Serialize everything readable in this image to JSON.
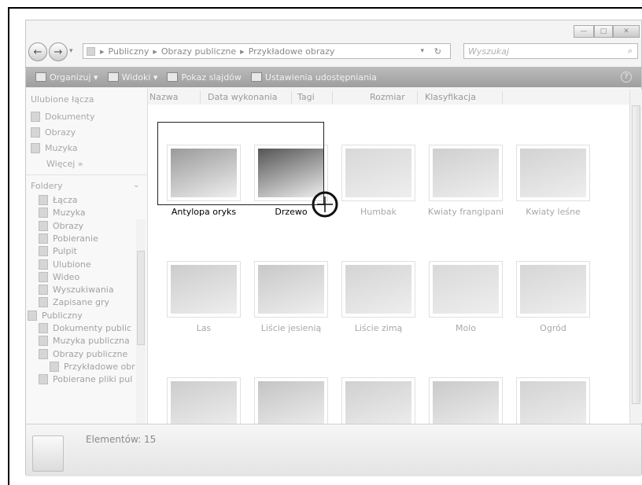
{
  "window": {
    "minimize": "—",
    "maximize": "□",
    "close": "✕"
  },
  "address": {
    "crumbs": [
      "Publiczny",
      "Obrazy publiczne",
      "Przykładowe obrazy"
    ],
    "search_placeholder": "Wyszukaj"
  },
  "toolbar": {
    "organize": "Organizuj",
    "views": "Widoki",
    "slideshow": "Pokaz slajdów",
    "sharing": "Ustawienia udostępniania"
  },
  "sidebar": {
    "favorites_header": "Ulubione łącza",
    "favorites": [
      "Dokumenty",
      "Obrazy",
      "Muzyka"
    ],
    "more": "Więcej »",
    "folders_header": "Foldery",
    "folders": [
      "Łącza",
      "Muzyka",
      "Obrazy",
      "Pobieranie",
      "Pulpit",
      "Ulubione",
      "Wideo",
      "Wyszukiwania",
      "Zapisane gry",
      "Publiczny",
      "Dokumenty public",
      "Muzyka publiczna",
      "Obrazy publiczne",
      "Przykładowe obr",
      "Pobierane pliki pul"
    ]
  },
  "columns": [
    "Nazwa",
    "Data wykonania",
    "Tagi",
    "Rozmiar",
    "Klasyfikacja"
  ],
  "items": [
    {
      "label": "Antylopa oryks",
      "selected": true,
      "color": "#9a9a9a"
    },
    {
      "label": "Drzewo",
      "selected": true,
      "color": "#555555"
    },
    {
      "label": "Humbak",
      "selected": false,
      "color": "#d8d8d8"
    },
    {
      "label": "Kwiaty frangipani",
      "selected": false,
      "color": "#cfcfcf"
    },
    {
      "label": "Kwiaty leśne",
      "selected": false,
      "color": "#d2d2d2"
    },
    {
      "label": "Las",
      "selected": false,
      "color": "#cccccc"
    },
    {
      "label": "Liście jesienią",
      "selected": false,
      "color": "#c8c8c8"
    },
    {
      "label": "Liście zimą",
      "selected": false,
      "color": "#d4d4d4"
    },
    {
      "label": "Molo",
      "selected": false,
      "color": "#d9d9d9"
    },
    {
      "label": "Ogród",
      "selected": false,
      "color": "#d6d6d6"
    },
    {
      "label": "",
      "selected": false,
      "color": "#cdcdcd"
    },
    {
      "label": "",
      "selected": false,
      "color": "#c4c4c4"
    },
    {
      "label": "",
      "selected": false,
      "color": "#d0d0d0"
    },
    {
      "label": "",
      "selected": false,
      "color": "#cacaca"
    },
    {
      "label": "",
      "selected": false,
      "color": "#d3d3d3"
    }
  ],
  "details": {
    "count_label": "Elementów: 15"
  }
}
